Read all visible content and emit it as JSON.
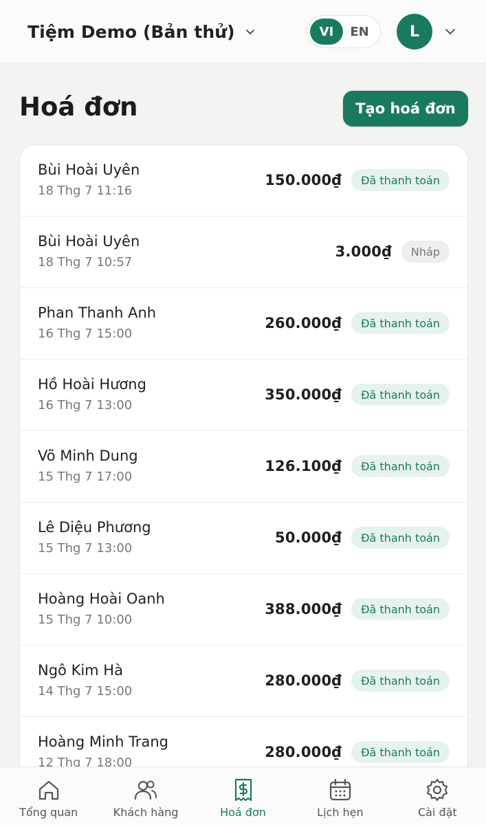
{
  "header": {
    "shop_name": "Tiệm Demo (Bản thử)",
    "lang": {
      "vi": "VI",
      "en": "EN",
      "active": "VI"
    },
    "avatar_initial": "L"
  },
  "page": {
    "title": "Hoá đơn",
    "create_label": "Tạo hoá đơn"
  },
  "invoices": [
    {
      "name": "Bùi Hoài Uyên",
      "date": "18 Thg 7 11:16",
      "amount": "150.000₫",
      "status": "Đã thanh toán",
      "status_type": "paid"
    },
    {
      "name": "Bùi Hoài Uyên",
      "date": "18 Thg 7 10:57",
      "amount": "3.000₫",
      "status": "Nháp",
      "status_type": "draft"
    },
    {
      "name": "Phan Thanh Anh",
      "date": "16 Thg 7 15:00",
      "amount": "260.000₫",
      "status": "Đã thanh toán",
      "status_type": "paid"
    },
    {
      "name": "Hồ Hoài Hương",
      "date": "16 Thg 7 13:00",
      "amount": "350.000₫",
      "status": "Đã thanh toán",
      "status_type": "paid"
    },
    {
      "name": "Võ Minh Dung",
      "date": "15 Thg 7 17:00",
      "amount": "126.100₫",
      "status": "Đã thanh toán",
      "status_type": "paid"
    },
    {
      "name": "Lê Diệu Phương",
      "date": "15 Thg 7 13:00",
      "amount": "50.000₫",
      "status": "Đã thanh toán",
      "status_type": "paid"
    },
    {
      "name": "Hoàng Hoài Oanh",
      "date": "15 Thg 7 10:00",
      "amount": "388.000₫",
      "status": "Đã thanh toán",
      "status_type": "paid"
    },
    {
      "name": "Ngô Kim Hà",
      "date": "14 Thg 7 15:00",
      "amount": "280.000₫",
      "status": "Đã thanh toán",
      "status_type": "paid"
    },
    {
      "name": "Hoàng Minh Trang",
      "date": "12 Thg 7 18:00",
      "amount": "280.000₫",
      "status": "Đã thanh toán",
      "status_type": "paid"
    }
  ],
  "nav": [
    {
      "label": "Tổng quan",
      "icon": "home-icon",
      "active": false
    },
    {
      "label": "Khách hàng",
      "icon": "users-icon",
      "active": false
    },
    {
      "label": "Hoá đơn",
      "icon": "receipt-icon",
      "active": true
    },
    {
      "label": "Lịch hẹn",
      "icon": "calendar-icon",
      "active": false
    },
    {
      "label": "Cài đặt",
      "icon": "gear-icon",
      "active": false
    }
  ],
  "colors": {
    "accent": "#1a7a5f",
    "paid_bg": "#e6f2ec",
    "draft_bg": "#eeeeec"
  }
}
